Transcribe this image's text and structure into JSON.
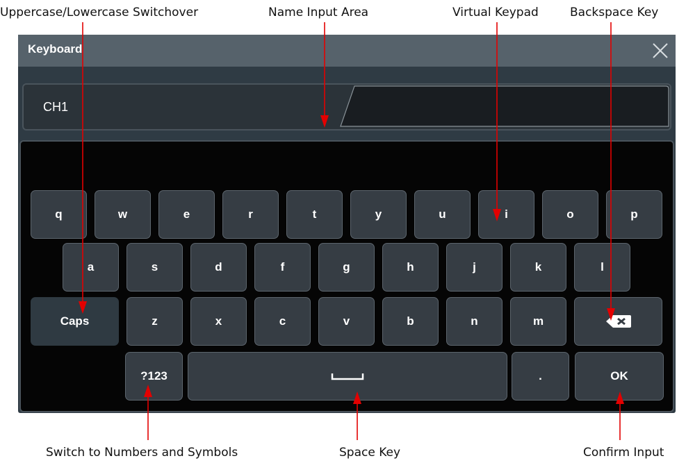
{
  "annotations": {
    "caps_switch": "Uppercase/Lowercase Switchover",
    "name_input": "Name Input Area",
    "virtual_keypad": "Virtual Keypad",
    "backspace": "Backspace Key",
    "numbers_symbols": "Switch to Numbers and Symbols",
    "space": "Space Key",
    "confirm": "Confirm Input"
  },
  "window": {
    "title": "Keyboard",
    "close_icon": "close-icon"
  },
  "name_input": {
    "value": "CH1"
  },
  "keys": {
    "row1": [
      "q",
      "w",
      "e",
      "r",
      "t",
      "y",
      "u",
      "i",
      "o",
      "p"
    ],
    "row2": [
      "a",
      "s",
      "d",
      "f",
      "g",
      "h",
      "j",
      "k",
      "l"
    ],
    "row3": [
      "z",
      "x",
      "c",
      "v",
      "b",
      "n",
      "m"
    ],
    "caps": "Caps",
    "numbers": "?123",
    "period": ".",
    "ok": "OK",
    "space_icon": "space-icon",
    "backspace_icon": "backspace-icon"
  },
  "colors": {
    "title_bar": "#56626b",
    "window": "#2f3b44",
    "keypad_bg": "#050505",
    "key": "#363d44",
    "arrow": "#e30000"
  }
}
